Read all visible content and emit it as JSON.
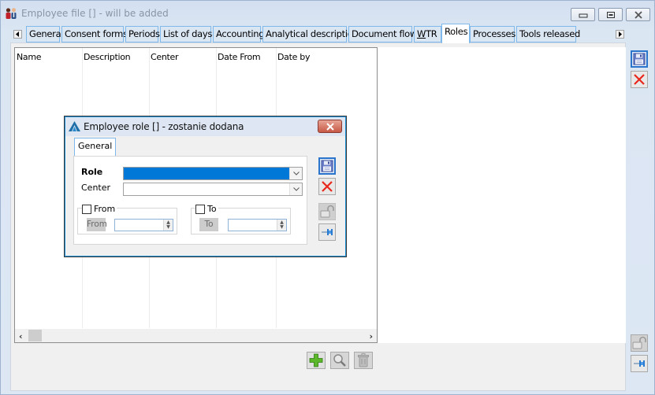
{
  "window": {
    "title": "Employee file [] - will be added",
    "app_icon": "employees-icon",
    "controls": [
      "minimize-icon",
      "restore-icon",
      "close-icon"
    ]
  },
  "tabs": [
    {
      "label": "General",
      "active": false
    },
    {
      "label": "Consent forms",
      "active": false
    },
    {
      "label": "Periods",
      "active": false
    },
    {
      "label": "List of days",
      "active": false
    },
    {
      "label": "Accounting",
      "active": false
    },
    {
      "label": "Analytical description",
      "active": false
    },
    {
      "label": "Document flow",
      "active": false
    },
    {
      "label": "WTR",
      "active": false,
      "mnemonic": "W"
    },
    {
      "label": "Roles",
      "active": true
    },
    {
      "label": "Processes",
      "active": false
    },
    {
      "label": "Tools released",
      "active": false
    }
  ],
  "grid": {
    "columns": [
      "Name",
      "Description",
      "Center",
      "Date From",
      "Date by"
    ],
    "rows": []
  },
  "side_toolbar": {
    "top": [
      {
        "icon": "save-icon"
      },
      {
        "icon": "cancel-icon"
      }
    ],
    "bottom": [
      {
        "icon": "unlock-icon"
      },
      {
        "icon": "pin-icon"
      }
    ]
  },
  "bottom_toolbar": [
    {
      "icon": "add-icon",
      "enabled": true
    },
    {
      "icon": "magnifier-icon",
      "enabled": false
    },
    {
      "icon": "trash-icon",
      "enabled": false
    }
  ],
  "dialog": {
    "title": "Employee role [] - zostanie dodana",
    "logo": "app-logo-icon",
    "tab": "General",
    "fields": {
      "role_label": "Role",
      "role_value": "",
      "center_label": "Center",
      "center_value": ""
    },
    "from_group": {
      "checkbox_label": "From",
      "button_label": "From",
      "value": "",
      "checked": false
    },
    "to_group": {
      "checkbox_label": "To",
      "button_label": "To",
      "value": "",
      "checked": false
    },
    "side_buttons": [
      "save-icon",
      "cancel-icon",
      "unlock-icon",
      "pin-icon"
    ]
  },
  "colors": {
    "tab_border": "#7fb8ea",
    "selection": "#0078d7",
    "focus_border": "#2a74cc",
    "cancel_red": "#e8261c",
    "add_green": "#5cb82a"
  }
}
